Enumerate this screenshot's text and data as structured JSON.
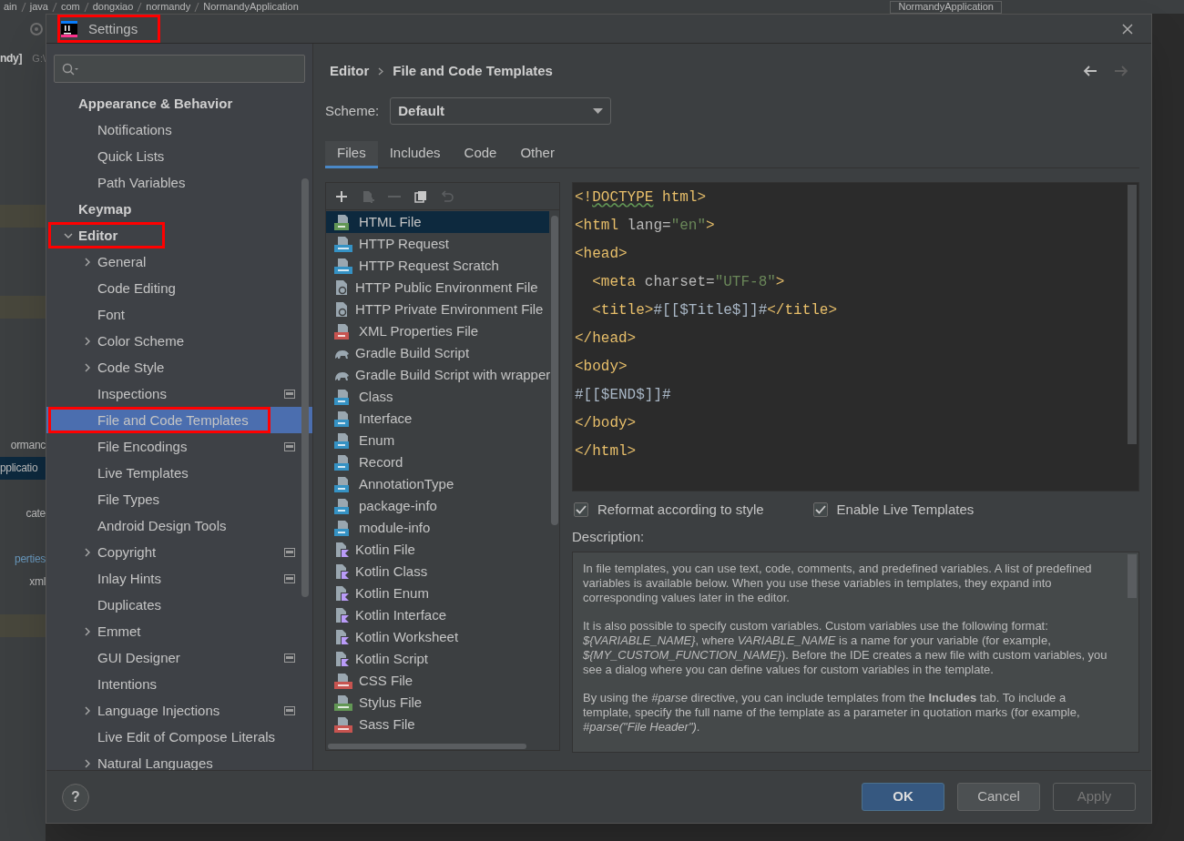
{
  "ide_background": {
    "breadcrumbs": [
      "ain",
      "java",
      "com",
      "dongxiao",
      "normandy",
      "NormandyApplication"
    ],
    "run_configuration": "NormandyApplication",
    "project_tree": [
      {
        "text": "ndy]",
        "kind": "bold",
        "selected": false
      },
      {
        "text": "ormanc",
        "kind": "plain",
        "selected": false
      },
      {
        "text": "pplicatio",
        "kind": "plain",
        "selected": true
      },
      {
        "text": "cate",
        "kind": "plain",
        "selected": false
      },
      {
        "text": "perties",
        "kind": "link",
        "selected": false
      },
      {
        "text": "xml",
        "kind": "plain",
        "selected": false
      }
    ],
    "path_hint": "G:\\"
  },
  "window": {
    "title": "Settings",
    "annotated": true
  },
  "sidebar": {
    "items": [
      {
        "label": "Appearance & Behavior",
        "children": [
          {
            "label": "Notifications",
            "selected": false
          },
          {
            "label": "Quick Lists",
            "selected": false
          },
          {
            "label": "Path Variables",
            "selected": false
          }
        ]
      },
      {
        "label": "Keymap"
      },
      {
        "label": "Editor",
        "expanded": true,
        "annotated": true,
        "children": [
          {
            "label": "General",
            "expanded": false,
            "selected": false
          },
          {
            "label": "Code Editing",
            "selected": false
          },
          {
            "label": "Font",
            "selected": false
          },
          {
            "label": "Color Scheme",
            "expanded": false,
            "selected": false
          },
          {
            "label": "Code Style",
            "expanded": false,
            "selected": false
          },
          {
            "label": "Inspections",
            "project_level": true,
            "selected": false
          },
          {
            "label": "File and Code Templates",
            "selected": true,
            "annotated": true
          },
          {
            "label": "File Encodings",
            "project_level": true,
            "selected": false
          },
          {
            "label": "Live Templates",
            "selected": false
          },
          {
            "label": "File Types",
            "selected": false
          },
          {
            "label": "Android Design Tools",
            "selected": false
          },
          {
            "label": "Copyright",
            "expanded": false,
            "project_level": true,
            "selected": false
          },
          {
            "label": "Inlay Hints",
            "project_level": true,
            "selected": false
          },
          {
            "label": "Duplicates",
            "selected": false
          },
          {
            "label": "Emmet",
            "expanded": false,
            "selected": false
          },
          {
            "label": "GUI Designer",
            "project_level": true,
            "selected": false
          },
          {
            "label": "Intentions",
            "selected": false
          },
          {
            "label": "Language Injections",
            "expanded": false,
            "project_level": true,
            "selected": false
          },
          {
            "label": "Live Edit of Compose Literals",
            "selected": false
          },
          {
            "label": "Natural Languages",
            "expanded": false,
            "selected": false
          }
        ]
      }
    ]
  },
  "breadcrumb": [
    "Editor",
    "File and Code Templates"
  ],
  "scheme": {
    "label": "Scheme:",
    "value": "Default"
  },
  "tabs": [
    {
      "label": "Files",
      "selected": true
    },
    {
      "label": "Includes",
      "selected": false
    },
    {
      "label": "Code",
      "selected": false
    },
    {
      "label": "Other",
      "selected": false
    }
  ],
  "toolbar": [
    {
      "kind": "add",
      "disabled": false
    },
    {
      "kind": "add-child",
      "disabled": true
    },
    {
      "kind": "remove",
      "disabled": true
    },
    {
      "kind": "copy",
      "disabled": false
    },
    {
      "kind": "reset",
      "disabled": true
    }
  ],
  "templates": [
    {
      "name": "HTML File",
      "kind": "html",
      "selected": true
    },
    {
      "name": "HTTP Request",
      "kind": "api",
      "selected": false
    },
    {
      "name": "HTTP Request Scratch",
      "kind": "api",
      "selected": false
    },
    {
      "name": "HTTP Public Environment File",
      "kind": "env",
      "selected": false
    },
    {
      "name": "HTTP Private Environment File",
      "kind": "env",
      "selected": false
    },
    {
      "name": "XML Properties File",
      "kind": "xml",
      "selected": false
    },
    {
      "name": "Gradle Build Script",
      "kind": "gradle",
      "selected": false
    },
    {
      "name": "Gradle Build Script with wrapper",
      "kind": "gradle",
      "selected": false
    },
    {
      "name": "Class",
      "kind": "java",
      "selected": false
    },
    {
      "name": "Interface",
      "kind": "java",
      "selected": false
    },
    {
      "name": "Enum",
      "kind": "java",
      "selected": false
    },
    {
      "name": "Record",
      "kind": "java",
      "selected": false
    },
    {
      "name": "AnnotationType",
      "kind": "java",
      "selected": false
    },
    {
      "name": "package-info",
      "kind": "java",
      "selected": false
    },
    {
      "name": "module-info",
      "kind": "java",
      "selected": false
    },
    {
      "name": "Kotlin File",
      "kind": "kotlin",
      "selected": false
    },
    {
      "name": "Kotlin Class",
      "kind": "kotlin",
      "selected": false
    },
    {
      "name": "Kotlin Enum",
      "kind": "kotlin",
      "selected": false
    },
    {
      "name": "Kotlin Interface",
      "kind": "kotlin",
      "selected": false
    },
    {
      "name": "Kotlin Worksheet",
      "kind": "kotlin",
      "selected": false
    },
    {
      "name": "Kotlin Script",
      "kind": "kotlin",
      "selected": false
    },
    {
      "name": "CSS File",
      "kind": "css",
      "selected": false
    },
    {
      "name": "Stylus File",
      "kind": "stylus",
      "selected": false
    },
    {
      "name": "Sass File",
      "kind": "sass",
      "selected": false
    }
  ],
  "code_lines": [
    [
      {
        "text": "<!",
        "kind": "tag"
      },
      {
        "text": "DOCTYPE",
        "kind": "typo"
      },
      {
        "text": " html>",
        "kind": "tag"
      }
    ],
    [
      {
        "text": "<html ",
        "kind": "tag"
      },
      {
        "text": "lang=",
        "kind": "attr"
      },
      {
        "text": "\"en\"",
        "kind": "string"
      },
      {
        "text": ">",
        "kind": "tag"
      }
    ],
    [
      {
        "text": "<head>",
        "kind": "tag"
      }
    ],
    [
      {
        "text": "  <meta ",
        "kind": "tag"
      },
      {
        "text": "charset=",
        "kind": "attr"
      },
      {
        "text": "\"UTF-8\"",
        "kind": "string"
      },
      {
        "text": ">",
        "kind": "tag"
      }
    ],
    [
      {
        "text": "  <title>",
        "kind": "tag"
      },
      {
        "text": "#[[$Title$]]#",
        "kind": "text"
      },
      {
        "text": "</title>",
        "kind": "tag"
      }
    ],
    [
      {
        "text": "</head>",
        "kind": "tag"
      }
    ],
    [
      {
        "text": "<body>",
        "kind": "tag"
      }
    ],
    [
      {
        "text": "#[[$END$]]#",
        "kind": "text"
      }
    ],
    [
      {
        "text": "</body>",
        "kind": "tag"
      }
    ],
    [
      {
        "text": "</html>",
        "kind": "tag"
      }
    ]
  ],
  "options": [
    {
      "label": "Reformat according to style",
      "checked": true
    },
    {
      "label": "Enable Live Templates",
      "checked": true
    }
  ],
  "description": {
    "label": "Description:",
    "paragraphs": [
      "In file templates, you can use text, code, comments, and predefined variables. A list of predefined variables is available below. When you use these variables in templates, they expand into corresponding values later in the editor.",
      "It is also possible to specify custom variables. Custom variables use the following format: *${VARIABLE_NAME}*, where *VARIABLE_NAME* is a name for your variable (for example, *${MY_CUSTOM_FUNCTION_NAME}*). Before the IDE creates a new file with custom variables, you see a dialog where you can define values for custom variables in the template.",
      "By using the *#parse* directive, you can include templates from the **Includes** tab. To include a template, specify the full name of the template as a parameter in quotation marks (for example, *#parse(\"File Header\")*."
    ]
  },
  "help_button": "?",
  "buttons": [
    {
      "label": "OK",
      "kind": "default",
      "disabled": false
    },
    {
      "label": "Cancel",
      "kind": "normal",
      "disabled": false
    },
    {
      "label": "Apply",
      "kind": "normal",
      "disabled": true
    }
  ]
}
